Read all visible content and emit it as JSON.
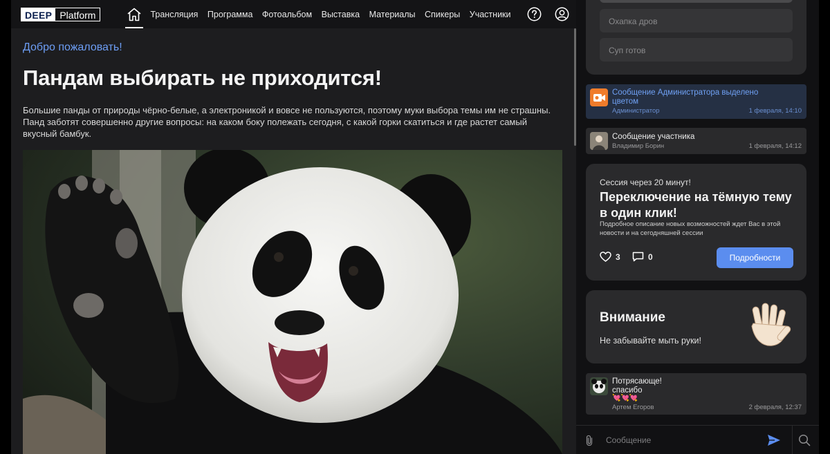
{
  "app": {
    "logo_left": "DEEP",
    "logo_right": "Platform",
    "accent": "#5b8def"
  },
  "nav": {
    "items": [
      "Трансляция",
      "Программа",
      "Фотоальбом",
      "Выставка",
      "Материалы",
      "Спикеры",
      "Участники"
    ]
  },
  "main": {
    "welcome": "Добро пожаловать!",
    "title": "Пандам выбирать не приходится!",
    "lead": "Большие панды от природы чёрно-белые, а электроникой и вовсе не пользуются, поэтому муки выбора темы им не страшны. Панд заботят совершенно другие вопросы: на каком боку полежать сегодня, с какой горки скатиться и где растет самый вкусный бамбук."
  },
  "poll": {
    "options": [
      "Охапка дров",
      "Суп готов"
    ]
  },
  "messages": [
    {
      "text": "Сообщение Администратора выделено цветом",
      "author": "Администратор",
      "time": "1 февраля, 14:10",
      "highlight": true
    },
    {
      "text": "Сообщение участника",
      "author": "Владимир Борин",
      "time": "1 февраля, 14:12",
      "highlight": false
    }
  ],
  "session": {
    "pre": "Сессия через 20 минут!",
    "title": "Переключение на тёмную тему в один клик!",
    "desc": "Подробное описание новых возможностей ждет Вас в этой новости и на сегодняшней сессии",
    "likes": "3",
    "comments": "0",
    "button": "Подробности"
  },
  "attention": {
    "title": "Внимание",
    "text": "Не забывайте мыть руки!",
    "icon": "raised-hand-icon"
  },
  "last_message": {
    "line1": "Потрясающе!",
    "line2": "спасибо",
    "emoji": "💘💘💘",
    "author": "Артем Егоров",
    "time": "2 февраля, 12:37"
  },
  "composer": {
    "placeholder": "Сообщение"
  }
}
